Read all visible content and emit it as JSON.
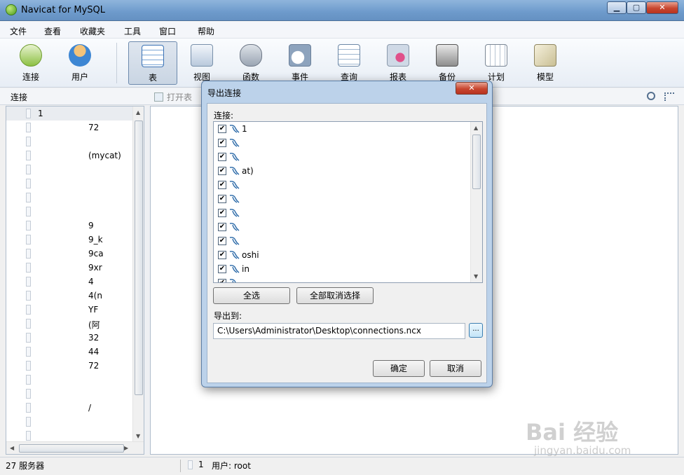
{
  "window": {
    "title": "Navicat for MySQL"
  },
  "menu": [
    "文件",
    "查看",
    "收藏夹",
    "工具",
    "窗口",
    "帮助"
  ],
  "toolbar": [
    {
      "label": "连接",
      "icon": "connection-icon"
    },
    {
      "label": "用户",
      "icon": "user-icon"
    },
    {
      "label": "表",
      "icon": "table-icon"
    },
    {
      "label": "视图",
      "icon": "view-icon"
    },
    {
      "label": "函数",
      "icon": "function-icon"
    },
    {
      "label": "事件",
      "icon": "event-icon"
    },
    {
      "label": "查询",
      "icon": "query-icon"
    },
    {
      "label": "报表",
      "icon": "report-icon"
    },
    {
      "label": "备份",
      "icon": "backup-icon"
    },
    {
      "label": "计划",
      "icon": "schedule-icon"
    },
    {
      "label": "模型",
      "icon": "model-icon"
    }
  ],
  "subbar": {
    "connection_label": "连接",
    "open_table": "打开表"
  },
  "tree": [
    "1",
    "72",
    "",
    "(mycat)",
    "",
    "",
    "",
    "",
    "9",
    "9_k",
    "9ca",
    "9xr",
    "4",
    "4(n",
    "YF",
    "(阿",
    "32",
    "44",
    "72",
    "",
    "",
    "/",
    "",
    ""
  ],
  "status": {
    "server_count": "27 服务器",
    "selected": "1",
    "user": "用户: root"
  },
  "dialog": {
    "title": "导出连接",
    "connections_label": "连接:",
    "connections": [
      "1",
      "",
      "",
      "at)",
      "",
      "",
      "",
      "",
      "",
      "oshi",
      "in",
      ""
    ],
    "select_all": "全选",
    "deselect_all": "全部取消选择",
    "export_to_label": "导出到:",
    "export_path": "C:\\Users\\Administrator\\Desktop\\connections.ncx",
    "browse": "...",
    "ok": "确定",
    "cancel": "取消"
  },
  "watermark": {
    "brand": "Bai 经验",
    "url": "jingyan.baidu.com"
  },
  "colors": {
    "titlebar": "#6d9acb",
    "dialog_frame": "#bcd2ea",
    "close_red": "#c8462f"
  }
}
